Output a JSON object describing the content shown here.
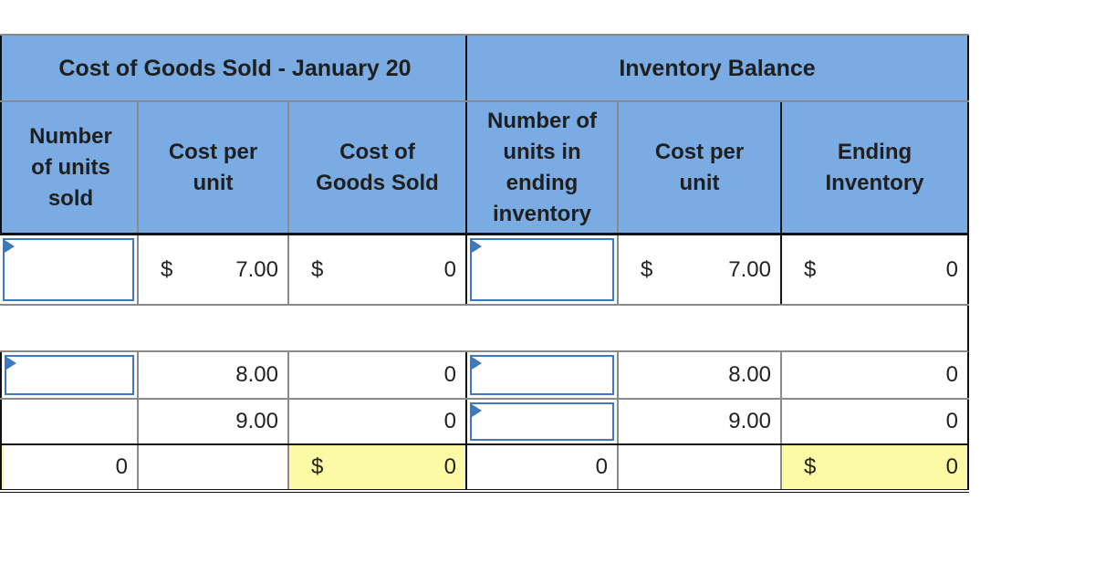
{
  "table": {
    "section_headers": {
      "cogs": "Cost of Goods Sold - January 20",
      "inventory": "Inventory Balance"
    },
    "column_headers": {
      "units_sold": "Number of units sold",
      "cogs_cost_per_unit": "Cost per unit",
      "cogs_total": "Cost of Goods Sold",
      "units_ending": "Number of units in ending inventory",
      "inv_cost_per_unit": "Cost per unit",
      "ending_inventory": "Ending Inventory"
    },
    "currency_symbol": "$",
    "rows": [
      {
        "units_sold": "",
        "cogs_cost_per_unit": "7.00",
        "cogs_total": "0",
        "units_ending": "",
        "inv_cost_per_unit": "7.00",
        "ending_inventory": "0",
        "show_dollar": true
      },
      {
        "units_sold": "",
        "cogs_cost_per_unit": "8.00",
        "cogs_total": "0",
        "units_ending": "",
        "inv_cost_per_unit": "8.00",
        "ending_inventory": "0",
        "show_dollar": false
      },
      {
        "units_sold": "",
        "cogs_cost_per_unit": "9.00",
        "cogs_total": "0",
        "units_ending": "",
        "inv_cost_per_unit": "9.00",
        "ending_inventory": "0",
        "show_dollar": false
      }
    ],
    "totals": {
      "units_sold": "0",
      "cogs_total": "0",
      "units_ending": "0",
      "ending_inventory": "0"
    }
  },
  "colors": {
    "header_bg": "#7aabe3",
    "input_border": "#3d78c1",
    "total_highlight": "#fdfaa6"
  }
}
